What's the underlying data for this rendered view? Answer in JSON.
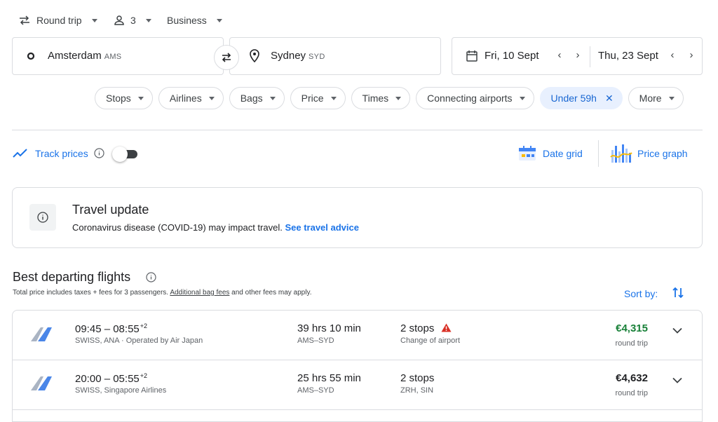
{
  "search": {
    "trip_type": "Round trip",
    "passengers": "3",
    "cabin_class": "Business",
    "origin_city": "Amsterdam",
    "origin_code": "AMS",
    "destination_city": "Sydney",
    "destination_code": "SYD",
    "depart_date": "Fri, 10 Sept",
    "return_date": "Thu, 23 Sept"
  },
  "filters": [
    {
      "label": "Stops"
    },
    {
      "label": "Airlines"
    },
    {
      "label": "Bags"
    },
    {
      "label": "Price"
    },
    {
      "label": "Times"
    },
    {
      "label": "Connecting airports"
    },
    {
      "label": "Under 59h"
    },
    {
      "label": "More"
    }
  ],
  "tools": {
    "track_prices": "Track prices",
    "track_prices_on": false,
    "date_grid": "Date grid",
    "price_graph": "Price graph"
  },
  "travel_update": {
    "title": "Travel update",
    "text": "Coronavirus disease (COVID-19) may impact travel.",
    "link": "See travel advice"
  },
  "results": {
    "title": "Best departing flights",
    "note_pre": "Total price includes taxes + fees for 3 passengers.",
    "note_link": "Additional bag fees",
    "note_post": "and other fees may apply.",
    "sort_label": "Sort by:",
    "flights": [
      {
        "times": "09:45 – 08:55",
        "plus_days": "+2",
        "airlines": "SWISS, ANA · Operated by Air Japan",
        "duration": "39 hrs 10 min",
        "route": "AMS–SYD",
        "stops": "2 stops",
        "stops_detail": "Change of airport",
        "price": "€4,315",
        "price_note": "round trip",
        "price_color": "#188038",
        "warning": true
      },
      {
        "times": "20:00 – 05:55",
        "plus_days": "+2",
        "airlines": "SWISS, Singapore Airlines",
        "duration": "25 hrs 55 min",
        "route": "AMS–SYD",
        "stops": "2 stops",
        "stops_detail": "ZRH, SIN",
        "price": "€4,632",
        "price_note": "round trip",
        "price_color": "#202124",
        "warning": false
      }
    ]
  },
  "colors": {
    "accent": "#1a73e8",
    "price_good": "#188038",
    "warning": "#d93025"
  }
}
